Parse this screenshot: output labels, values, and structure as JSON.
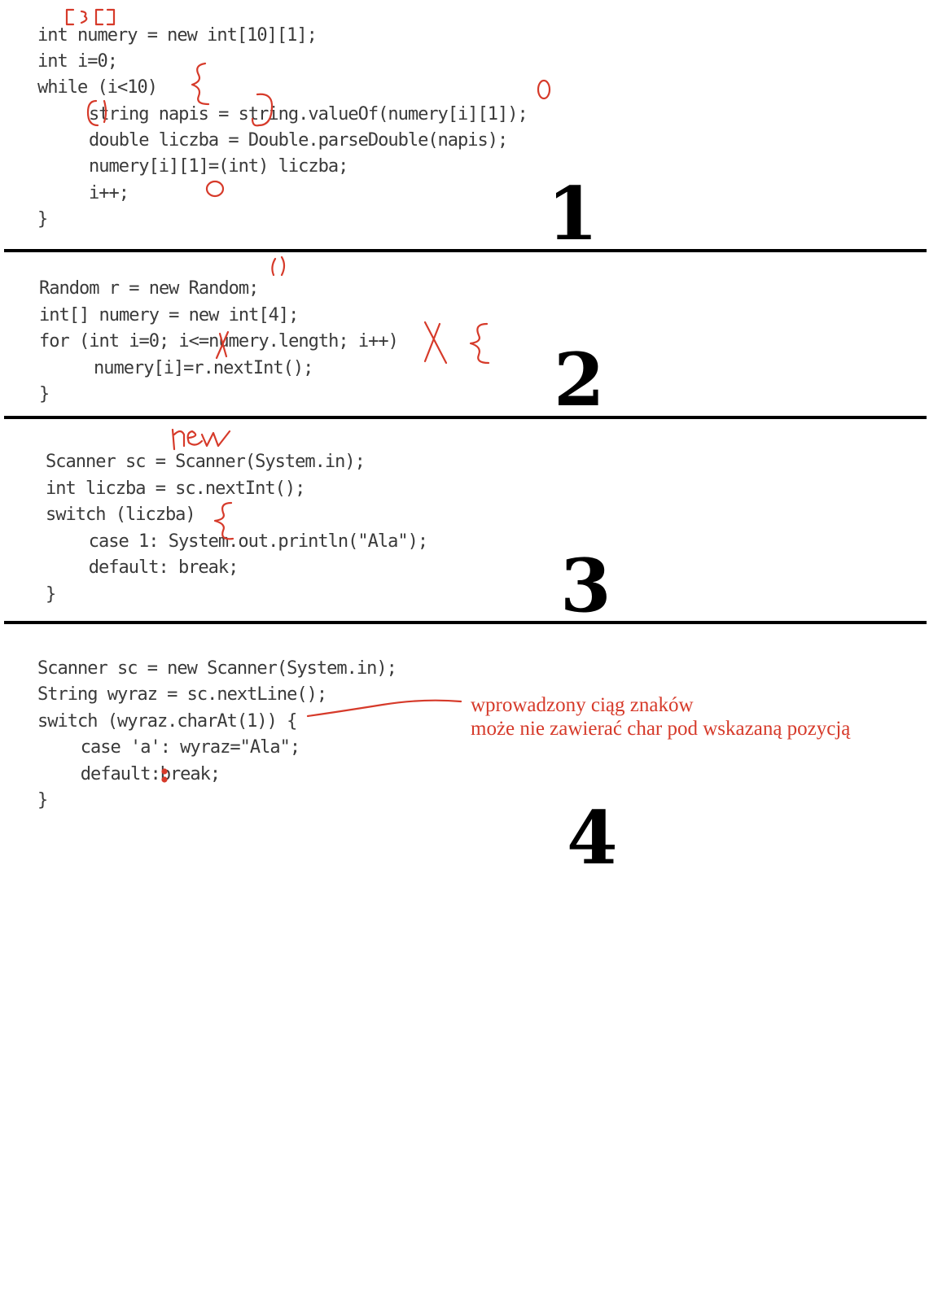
{
  "section1": {
    "number": "1",
    "lines": [
      "int numery = new int[10][1];",
      "int i=0;",
      "while (i<10)",
      "    string napis = string.valueOf(numery[i][1]);",
      "    double liczba = Double.parseDouble(napis);",
      "    numery[i][1]=(int) liczba;",
      "    i++;",
      "}"
    ]
  },
  "section2": {
    "number": "2",
    "lines": [
      "Random r = new Random;",
      "int[] numery = new int[4];",
      "for (int i=0; i<=numery.length; i++)",
      "    numery[i]=r.nextInt();",
      "}"
    ]
  },
  "section3": {
    "number": "3",
    "lines": [
      "Scanner sc = Scanner(System.in);",
      "int liczba = sc.nextInt();",
      "switch (liczba)",
      "   case 1: System.out.println(\"Ala\");",
      "   default: break;",
      "}"
    ]
  },
  "section4": {
    "number": "4",
    "lines": [
      "Scanner sc = new Scanner(System.in);",
      "String wyraz = sc.nextLine();",
      "switch (wyraz.charAt(1)) {",
      "   case 'a': wyraz=\"Ala\";",
      "   default:break;",
      "}"
    ],
    "note_line1": "wprowadzony ciąg znaków",
    "note_line2": "może nie zawierać char pod wskazaną pozycją"
  },
  "annotations": {
    "bracket_fix": "[3[]",
    "zero_mark": "0",
    "new_mark": "new"
  },
  "colors": {
    "code": "#3a3a3a",
    "annotation": "#d63a2a",
    "divider": "#000000"
  }
}
